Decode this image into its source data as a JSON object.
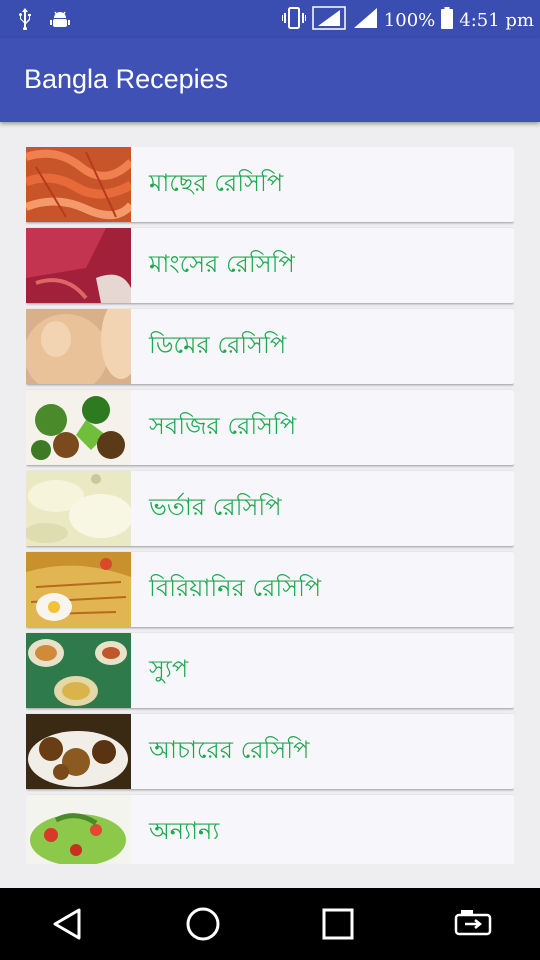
{
  "status_bar": {
    "battery_percent": "100%",
    "time": "4:51 pm",
    "icons": [
      "usb-icon",
      "android-debug-icon",
      "vibrate-icon",
      "signal-icon",
      "signal-icon",
      "battery-icon"
    ]
  },
  "app_bar": {
    "title": "Bangla Recepies",
    "color": "#3f51b5"
  },
  "list": {
    "label_color": "#1fa84f",
    "items": [
      {
        "label": "মাছের রেসিপি",
        "image": "shrimp-photo"
      },
      {
        "label": "মাংসের রেসিপি",
        "image": "meat-photo"
      },
      {
        "label": "ডিমের রেসিপি",
        "image": "egg-photo"
      },
      {
        "label": "সবজির রেসিপি",
        "image": "vegetable-photo"
      },
      {
        "label": "ভর্তার রেসিপি",
        "image": "mash-photo"
      },
      {
        "label": " বিরিয়ানির রেসিপি",
        "image": "biryani-photo"
      },
      {
        "label": "স্যুপ",
        "image": "soup-photo"
      },
      {
        "label": "আচারের রেসিপি",
        "image": "pickle-photo"
      },
      {
        "label": "অন্যান্য",
        "image": "salad-photo"
      }
    ]
  },
  "nav_bar": {
    "buttons": [
      "back-icon",
      "home-icon",
      "recents-icon",
      "screen-mirror-icon"
    ]
  }
}
